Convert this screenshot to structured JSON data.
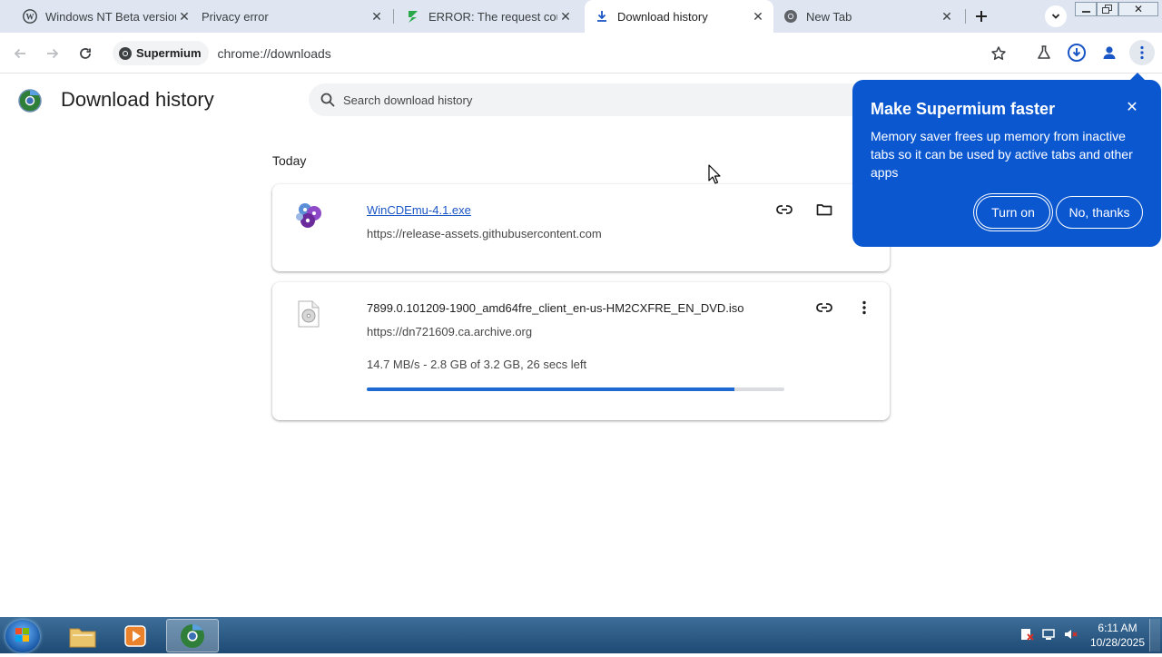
{
  "tabs": [
    {
      "title": "Windows NT Beta version",
      "icon": "wordpress-icon"
    },
    {
      "title": "Privacy error",
      "icon": "none"
    },
    {
      "title": "ERROR: The request could",
      "icon": "zap-icon"
    },
    {
      "title": "Download history",
      "icon": "download-icon"
    },
    {
      "title": "New Tab",
      "icon": "chromium-icon"
    }
  ],
  "window_controls": {
    "minimize": "minimize",
    "restore": "restore",
    "close": "close"
  },
  "omnibox": {
    "chip_label": "Supermium",
    "url": "chrome://downloads"
  },
  "page": {
    "title": "Download history",
    "search_placeholder": "Search download history",
    "day_label": "Today"
  },
  "downloads": [
    {
      "file_name": "WinCDEmu-4.1.exe",
      "source_url": "https://release-assets.githubusercontent.com",
      "icon": "wincdemu-icon"
    },
    {
      "file_name": "7899.0.101209-1900_amd64fre_client_en-us-HM2CXFRE_EN_DVD.iso",
      "source_url": "https://dn721609.ca.archive.org",
      "progress_text": "14.7 MB/s - 2.8 GB of 3.2 GB, 26 secs left",
      "progress_fraction": 0.88,
      "icon": "disc-file-icon"
    }
  ],
  "bubble": {
    "title": "Make Supermium faster",
    "body": "Memory saver frees up memory from inactive tabs so it can be used by active tabs and other apps",
    "turn_on": "Turn on",
    "no_thanks": "No, thanks"
  },
  "taskbar": {
    "time": "6:11 AM",
    "date": "10/28/2025"
  },
  "colors": {
    "accent": "#0b57d0",
    "progress": "#1f6ad2",
    "link": "#1a56c5",
    "tabstrip": "#dfe6f1"
  }
}
